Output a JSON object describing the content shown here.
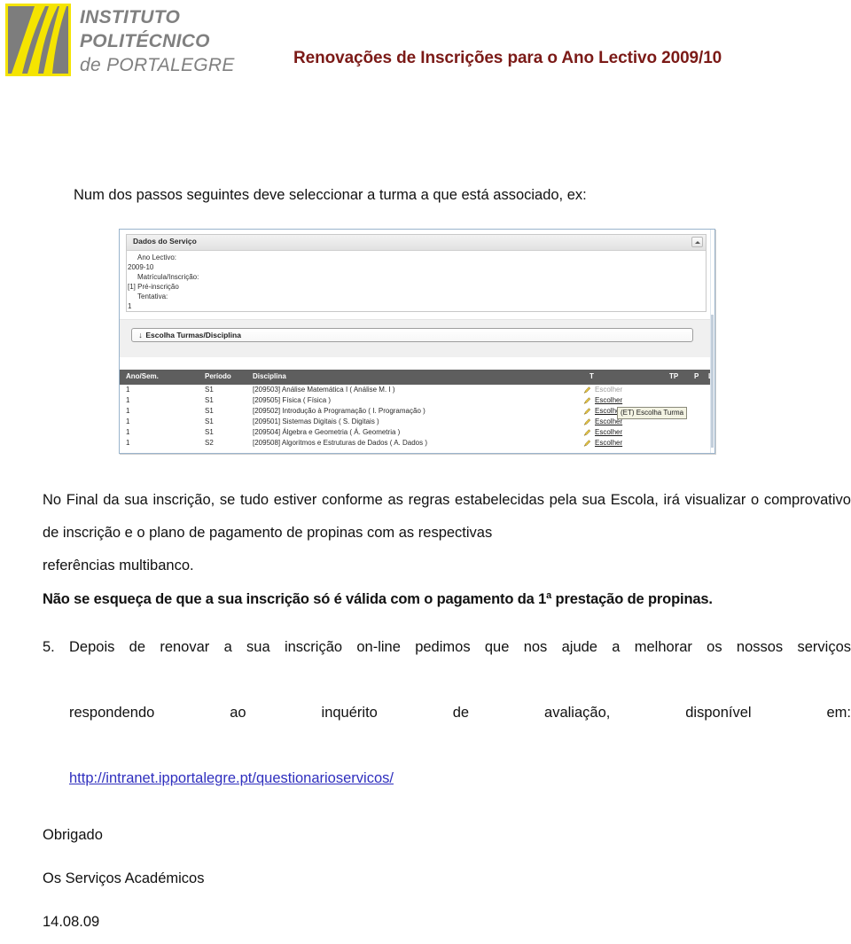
{
  "header": {
    "logo": {
      "mark_name": "ipp-logo-mark",
      "line1": "INSTITUTO",
      "line2": "POLITÉCNICO",
      "line3": "de PORTALEGRE",
      "mark_bg": "#7d7d7d",
      "mark_stripe": "#f5e400",
      "text_color": "#808080"
    },
    "title": "Renovações de Inscrições para o Ano Lectivo 2009/10",
    "title_color": "#7b1a17"
  },
  "content": {
    "lead_line": "Num dos passos seguintes deve seleccionar a turma a que está associado, ex:",
    "final_paragraph": "No Final da sua inscrição, se tudo estiver conforme as regras estabelecidas pela sua Escola, irá visualizar o comprovativo de inscrição e o plano de pagamento de propinas com as respectivas",
    "final_paragraph_lastline": "referências multibanco.",
    "bold_notice": "Não se esqueça de que a sua inscrição só é válida com o pagamento da 1ª prestação de propinas.",
    "list_item": {
      "number": "5.",
      "line1": "Depois de renovar a sua inscrição on-line pedimos que nos ajude a melhorar os nossos serviços",
      "line2": "respondendo ao inquérito de avaliação, disponível em:",
      "link_text": "http://intranet.ipportalegre.pt/questionarioservicos/",
      "link_color": "#2f2fbe"
    },
    "closing": {
      "thanks": "Obrigado",
      "signature": "Os Serviços Académicos",
      "date": "14.08.09"
    }
  },
  "app_screenshot": {
    "panel": {
      "title": "Dados do Serviço",
      "collapse_button_label": "",
      "fields": [
        {
          "label": "Ano Lectivo:",
          "value": "2009-10"
        },
        {
          "label": "Matrícula/Inscrição:",
          "value": "[1] Pré-inscrição"
        },
        {
          "label": "Tentativa:",
          "value": "1"
        }
      ]
    },
    "toolbar": {
      "choose_classes_label": "Escolha Turmas/Disciplina",
      "download_icon_glyph": "↓"
    },
    "grid": {
      "columns": {
        "ano_sem": "Ano/Sem.",
        "periodo": "Período",
        "disciplina": "Disciplina",
        "t": "T",
        "tp": "TP",
        "p": "P",
        "ls": "L/S"
      },
      "rows": [
        {
          "ano_sem": "1",
          "periodo": "S1",
          "disciplina": "[209503] Análise Matemática I ( Análise M. I )",
          "action": "Escolher",
          "action_state": "disabled"
        },
        {
          "ano_sem": "1",
          "periodo": "S1",
          "disciplina": "[209505] Física ( Física )",
          "action": "Escolher",
          "action_state": "enabled"
        },
        {
          "ano_sem": "1",
          "periodo": "S1",
          "disciplina": "[209502] Introdução à Programação ( I. Programação )",
          "action": "Escolher",
          "action_state": "enabled"
        },
        {
          "ano_sem": "1",
          "periodo": "S1",
          "disciplina": "[209501] Sistemas Digitais ( S. Digitais )",
          "action": "Escolher",
          "action_state": "enabled"
        },
        {
          "ano_sem": "1",
          "periodo": "S1",
          "disciplina": "[209504] Álgebra e Geometria ( Á. Geometria )",
          "action": "Escolher",
          "action_state": "enabled"
        },
        {
          "ano_sem": "1",
          "periodo": "S2",
          "disciplina": "[209508] Algoritmos e Estruturas de Dados ( A. Dados )",
          "action": "Escolher",
          "action_state": "enabled"
        }
      ],
      "tooltip": "(ET) Escolha Turma"
    }
  }
}
